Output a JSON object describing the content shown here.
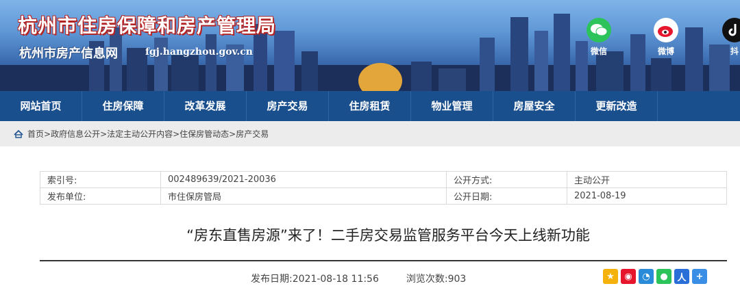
{
  "header": {
    "title": "杭州市住房保障和房产管理局",
    "subtitle": "杭州市房产信息网",
    "domain": "fgj.hangzhou.gov.cn"
  },
  "social": {
    "wechat": "微信",
    "weibo": "微博",
    "douyin": "抖"
  },
  "nav": [
    "网站首页",
    "住房保障",
    "改革发展",
    "房产交易",
    "住房租赁",
    "物业管理",
    "房屋安全",
    "更新改造"
  ],
  "breadcrumb": {
    "home": "首页",
    "path": ">政府信息公开>法定主动公开内容>住保房管动态>房产交易"
  },
  "info": {
    "index_label": "索引号:",
    "index_value": "002489639/2021-20036",
    "method_label": "公开方式:",
    "method_value": "主动公开",
    "publisher_label": "发布单位:",
    "publisher_value": "市住保房管局",
    "date_label": "公开日期:",
    "date_value": "2021-08-19"
  },
  "article": {
    "title": "“房东直售房源”来了！二手房交易监管服务平台今天上线新功能",
    "publish_label": "发布日期:",
    "publish_value": "2021-08-18 11:56",
    "views_label": "浏览次数:",
    "views_value": "903"
  },
  "colors": {
    "nav_bg": "#1a4f8e",
    "title_stroke": "#b52424"
  },
  "share_icons": [
    "qzone-icon",
    "weibo-share-icon",
    "qq-share-icon",
    "wechat-share-icon",
    "people-share-icon",
    "more-share-icon"
  ]
}
